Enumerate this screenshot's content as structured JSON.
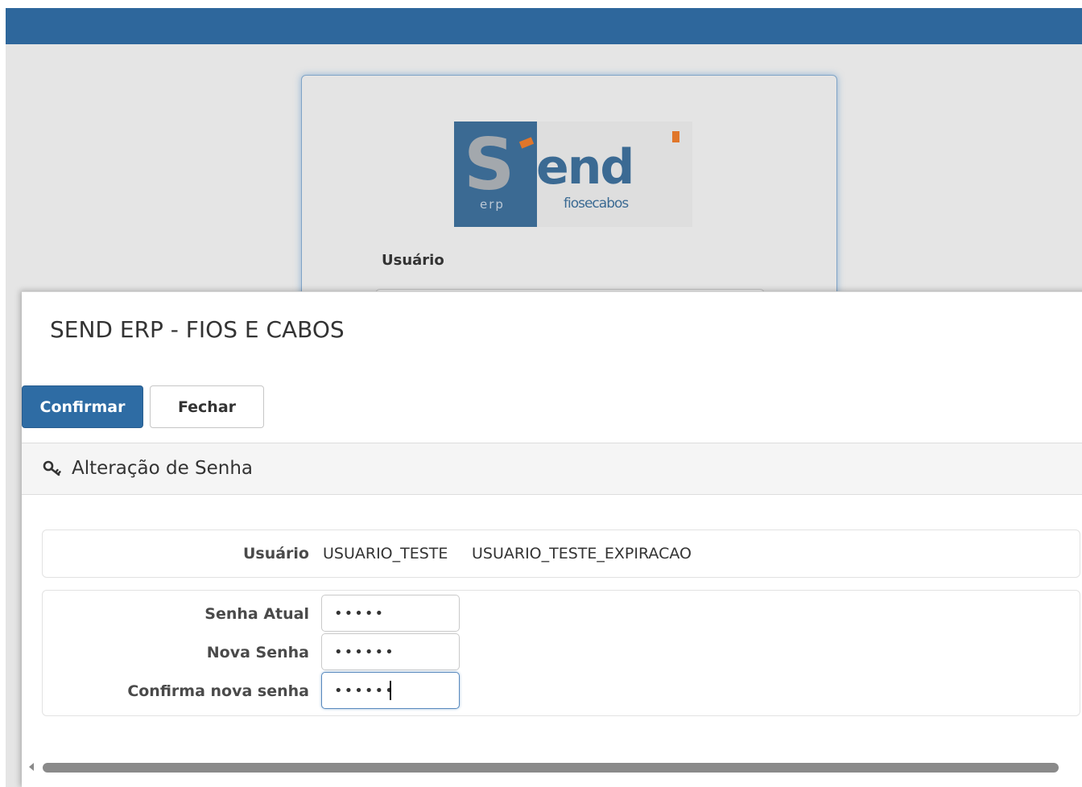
{
  "login": {
    "logo": {
      "main_text": "end",
      "initial": "S",
      "sub_left": "erp",
      "sub_right": "fiosecabos"
    },
    "user_label": "Usuário"
  },
  "dialog": {
    "title": "SEND ERP - FIOS E CABOS",
    "buttons": {
      "confirm": "Confirmar",
      "close": "Fechar"
    },
    "section": {
      "icon": "key-icon",
      "title": "Alteração de Senha"
    },
    "user_row": {
      "label": "Usuário",
      "login": "USUARIO_TESTE",
      "name": "USUARIO_TESTE_EXPIRACAO"
    },
    "fields": {
      "current_password": {
        "label": "Senha Atual",
        "value": "•••••"
      },
      "new_password": {
        "label": "Nova Senha",
        "value": "••••••"
      },
      "confirm_password": {
        "label": "Confirma nova senha",
        "value": "••••••"
      }
    }
  },
  "colors": {
    "topbar": "#2e679c",
    "primary_button": "#2e6ca4",
    "logo_blue": "#3b6a93",
    "logo_accent": "#e0762a"
  }
}
